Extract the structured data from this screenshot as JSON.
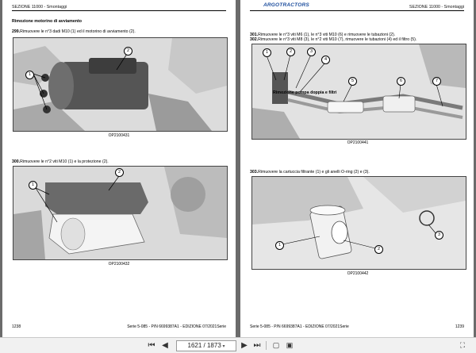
{
  "left_page": {
    "header": "SEZIONE 11000 - Smontaggi",
    "section_title": "Rimozione motorino di avviamento",
    "steps": [
      {
        "num": "299.",
        "text": "Rimuovere le n°3 dadi M10 (1) ed il motorino di avviamento (2)."
      },
      {
        "num": "300.",
        "text": "Rimuovere le n°2 viti M10 (1) e la protezione (2)."
      }
    ],
    "fig1_callouts": [
      "1",
      "2"
    ],
    "fig1_caption": "OP2100431",
    "fig2_callouts": [
      "1",
      "2"
    ],
    "fig2_caption": "OP2100432",
    "page_number": "1238",
    "footer": "Serie 5-085 - P/N 6699387A1 - EDIZIONE 07/2021Serie"
  },
  "right_page": {
    "brand": "ARGOTRACTORS",
    "header": "SEZIONE 11000 - Smontaggi",
    "steps": [
      {
        "num": "301.",
        "text": "Rimuovere le n°3 viti M6 (1), le n°3 viti M10 (6) e rimuovere le tubazioni (2)."
      },
      {
        "num": "302.",
        "text": "Rimuovere le n°3 viti M8 (3), le n°2 viti M10 (7), rimuovere le tubazioni (4) ed il filtro (5)."
      },
      {
        "num": "303.",
        "text": "Rimuovere la cartuccia filtrante (1) e gli anelli O-ring (2) e (3)."
      }
    ],
    "section_title": "Rimozione pompa doppia e filtri",
    "fig1_callouts": [
      "1",
      "2",
      "3",
      "4",
      "5",
      "6",
      "7"
    ],
    "fig1_caption": "OP2100441",
    "fig2_callouts": [
      "1",
      "2",
      "3"
    ],
    "fig2_caption": "OP2100442",
    "page_number": "1239",
    "footer": "Serie 5-085 - P/N 6699387A1 - EDIZIONE 07/2021Serie"
  },
  "toolbar": {
    "page_indicator": "1621 / 1873",
    "first_icon": "skip-first-icon",
    "prev_icon": "previous-icon",
    "next_icon": "next-icon",
    "last_icon": "skip-last-icon"
  }
}
